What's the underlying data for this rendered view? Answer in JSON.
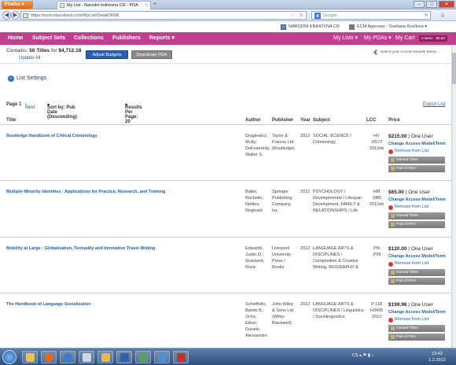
{
  "browser": {
    "firefox_label": "Firefox",
    "tab_title": "My List - Narodni knihovna CR - PDA",
    "url": "https://ecm.ebscohost.com/MyList/Detail/3098",
    "url_prefix": "ebscohost",
    "search_placeholder": "Google"
  },
  "header": {
    "institution": "NARODNI KNIHOVNA CR",
    "user": "ECM Approver - Svetlana Knollova"
  },
  "nav": {
    "home": "Home",
    "subject_sets": "Subject Sets",
    "collections": "Collections",
    "publishers": "Publishers",
    "reports": "Reports",
    "my_lists": "My Lists",
    "my_pdas": "My PDAs",
    "my_cart": "My Cart",
    "cart_badge": "0 items · $0.00"
  },
  "summary": {
    "contains_label": "Contains:",
    "titles": "50 Titles",
    "for_label": "for",
    "amount": "$4,712.18",
    "update_all": "Update All",
    "adjust_budgets": "Adjust Budgets",
    "deactivate_pda": "Deactivate PDA",
    "hint": "Select your Access Models below"
  },
  "settings": {
    "label": "List Settings"
  },
  "pager": {
    "page": "Page 1",
    "next": "Next",
    "sort": "Sort by: Pub Date (Descending)",
    "results": "Results Per Page: 20",
    "export": "Export List"
  },
  "columns": {
    "title": "Title",
    "author": "Author",
    "publisher": "Publisher",
    "year": "Year",
    "subject": "Subject",
    "lcc": "LCC",
    "price": "Price"
  },
  "rows": [
    {
      "title": "Routledge Handbook of Critical Criminology",
      "author": "Dragiewicz, Molly; DeKeseredy, Walter S.",
      "publisher": "Taylor & Francis Ltd (Routledge)",
      "year": "2012",
      "subject": "SOCIAL SCIENCE / Criminology",
      "lcc": "HV .R577 2012eb",
      "price": "$215.00",
      "users": "One User",
      "change": "Change Access Model/Term",
      "remove": "Remove from List",
      "owned": "Owned Titles",
      "pda": "Part of PDA"
    },
    {
      "title": "Multiple Minority Identities : Applications for Practice, Research, and Training",
      "author": "Ballet, Rochelle; Nettles, Reginald",
      "publisher": "Springer Publishing Company, Inc",
      "year": "2012",
      "subject": "PSYCHOLOGY / Developmental / Lifespan Development, FAMILY & RELATIONSHIPS / Life",
      "lcc": "HM .M85 2012eb",
      "price": "$65.00",
      "users": "One User",
      "change": "Change Access Model/Term",
      "remove": "Remove from List",
      "owned": "Owned Titles",
      "pda": "Part of PDA"
    },
    {
      "title": "Mobility at Large : Globalization, Textuality and Innovative Travel Writing",
      "author": "Edwards, Justin D.; Graulund, Rune",
      "publisher": "Liverpool University Press / Books",
      "year": "2012",
      "subject": "LANGUAGE ARTS & DISCIPLINES / Composition & Creative Writing, BIOGRAPHY &",
      "lcc": "PN .P56",
      "price": "$120.00",
      "users": "One User",
      "change": "Change Access Model/Term",
      "remove": "Remove from List",
      "owned": "Owned Titles",
      "pda": "Part of PDA"
    },
    {
      "title": "The Handbook of Language Socialization",
      "author": "Schieffelin, Bambi B.; Ochs, Elinor; Duranti, Alessandro",
      "publisher": "John Wiley & Sons Ltd (Wiley-Blackwell)",
      "year": "2012",
      "subject": "LANGUAGE ARTS & DISCIPLINES / Linguistics / Sociolinguistics",
      "lcc": "P 118 H3495 2012",
      "price": "$199.96",
      "users": "One User",
      "change": "Change Access Model/Term",
      "remove": "Remove from List",
      "owned": "Owned Titles",
      "pda": "Part of PDA"
    }
  ],
  "taskbar": {
    "lang": "CS",
    "time": "13:42",
    "date": "1.2.2013"
  },
  "colors": {
    "brand": "#c23f8f",
    "link": "#1f5ea8",
    "button": "#2b5fb4"
  }
}
